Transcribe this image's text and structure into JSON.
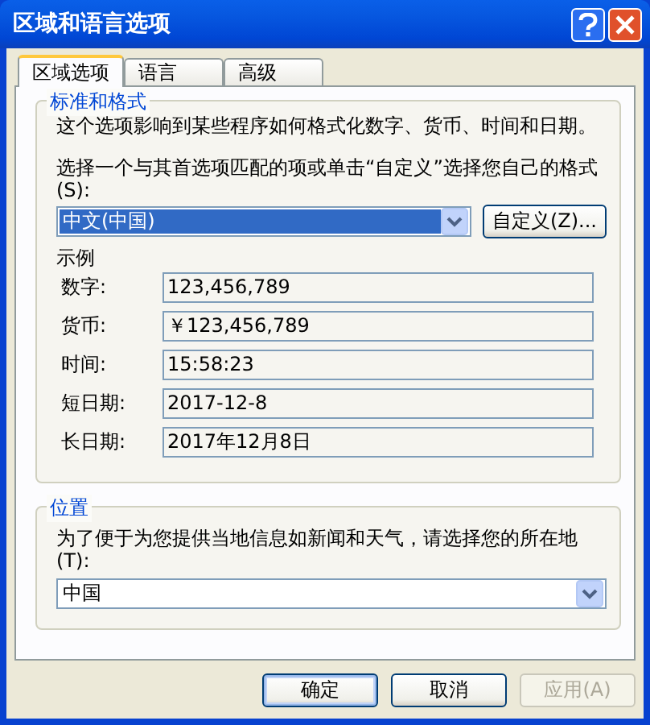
{
  "window": {
    "title": "区域和语言选项"
  },
  "tabs": [
    {
      "label": "区域选项",
      "selected": true
    },
    {
      "label": "语言",
      "selected": false
    },
    {
      "label": "高级",
      "selected": false
    }
  ],
  "standards": {
    "title": "标准和格式",
    "description": "这个选项影响到某些程序如何格式化数字、货币、时间和日期。",
    "prompt": "选择一个与其首选项匹配的项或单击“自定义”选择您自己的格式(S):",
    "format": {
      "value": "中文(中国)",
      "highlighted": true
    },
    "customize_button": "自定义(Z)...",
    "samples_title": "示例",
    "samples": [
      {
        "label": "数字:",
        "value": "123,456,789"
      },
      {
        "label": "货币:",
        "value": "￥123,456,789"
      },
      {
        "label": "时间:",
        "value": "15:58:23"
      },
      {
        "label": "短日期:",
        "value": "2017-12-8"
      },
      {
        "label": "长日期:",
        "value": "2017年12月8日"
      }
    ]
  },
  "location": {
    "title": "位置",
    "prompt": "为了便于为您提供当地信息如新闻和天气，请选择您的所在地(T):",
    "select": {
      "value": "中国"
    }
  },
  "buttons": [
    {
      "label": "确定",
      "disabled": false,
      "focused": true
    },
    {
      "label": "取消",
      "disabled": false,
      "focused": false
    },
    {
      "label": "应用(A)",
      "disabled": true,
      "focused": false
    }
  ]
}
